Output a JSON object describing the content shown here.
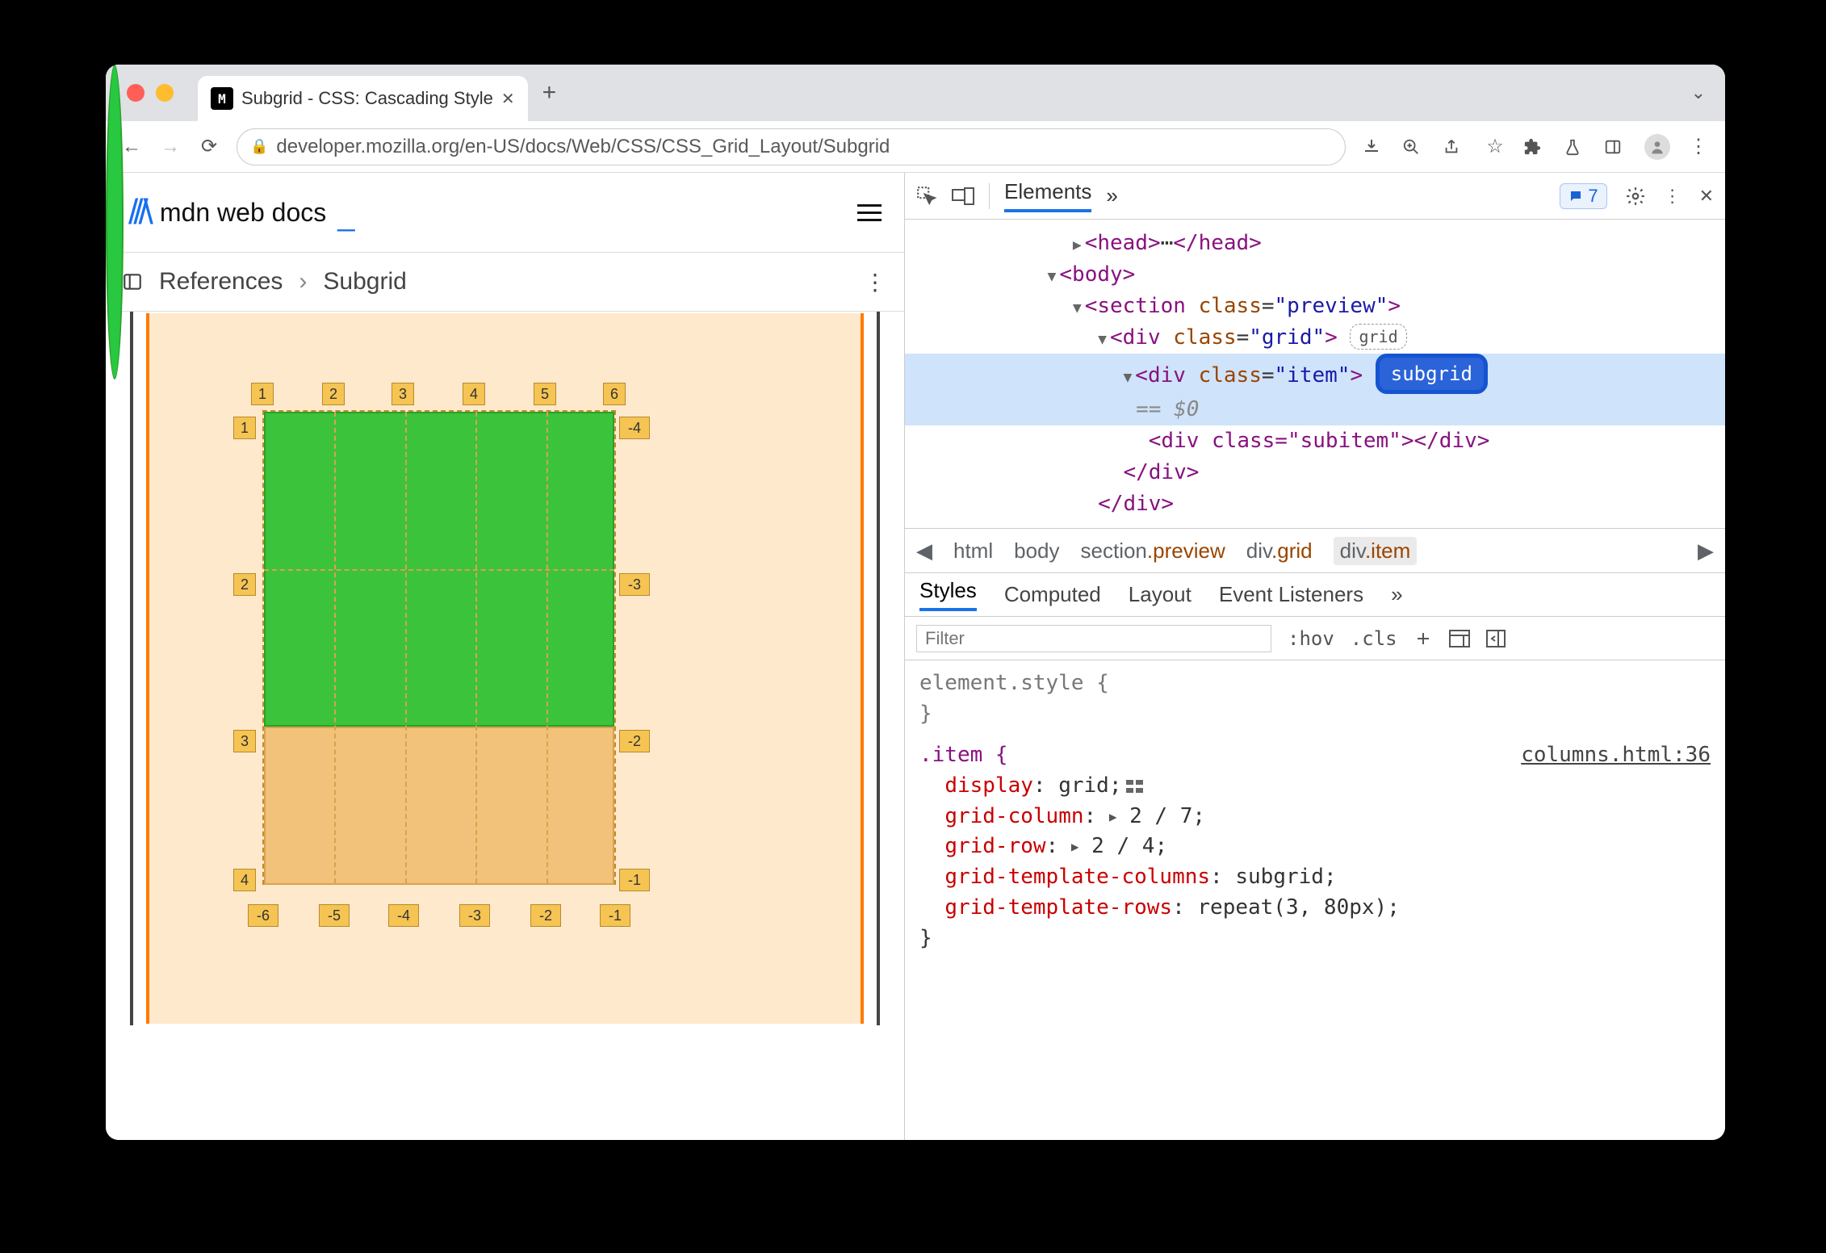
{
  "tab": {
    "title": "Subgrid - CSS: Cascading Style"
  },
  "url": "developer.mozilla.org/en-US/docs/Web/CSS/CSS_Grid_Layout/Subgrid",
  "mdn": {
    "brand": "mdn web docs"
  },
  "breadcrumbs": {
    "root": "References",
    "leaf": "Subgrid"
  },
  "grid_labels": {
    "top": [
      "1",
      "2",
      "3",
      "4",
      "5",
      "6"
    ],
    "left": [
      "1",
      "2",
      "3",
      "4"
    ],
    "right": [
      "-4",
      "-3",
      "-2",
      "-1"
    ],
    "bottom": [
      "-6",
      "-5",
      "-4",
      "-3",
      "-2",
      "-1"
    ]
  },
  "devtools": {
    "panel": "Elements",
    "issues": "7",
    "dom": {
      "head_open": "<head>",
      "head_ell": "⋯",
      "head_close": "</head>",
      "body": "<body>",
      "section_open": "<section ",
      "section_attr": "class",
      "section_val": "\"preview\"",
      "section_end": ">",
      "grid_open": "<div ",
      "grid_attr": "class",
      "grid_val": "\"grid\"",
      "grid_end": ">",
      "grid_badge": "grid",
      "item_open": "<div ",
      "item_attr": "class",
      "item_val": "\"item\"",
      "item_end": ">",
      "item_badge": "subgrid",
      "eq": "== ",
      "dollar": "$0",
      "subitem": "<div class=\"subitem\"></div>",
      "div_close": "</div>"
    },
    "crumb": {
      "a": "html",
      "b": "body",
      "c1": "section",
      "c2": ".preview",
      "d1": "div",
      "d2": ".grid",
      "e1": "div",
      "e2": ".item"
    },
    "subtabs": {
      "styles": "Styles",
      "computed": "Computed",
      "layout": "Layout",
      "events": "Event Listeners"
    },
    "filter": {
      "ph": "Filter",
      "hov": ":hov",
      "cls": ".cls"
    },
    "css": {
      "elstyle": "element.style {",
      "close": "}",
      "sel": ".item {",
      "src": "columns.html:36",
      "p1": "display",
      "v1": "grid",
      "p2": "grid-column",
      "v2": "2 / 7",
      "p3": "grid-row",
      "v3": "2 / 4",
      "p4": "grid-template-columns",
      "v4": "subgrid",
      "p5": "grid-template-rows",
      "v5": "repeat(3, 80px)"
    }
  }
}
